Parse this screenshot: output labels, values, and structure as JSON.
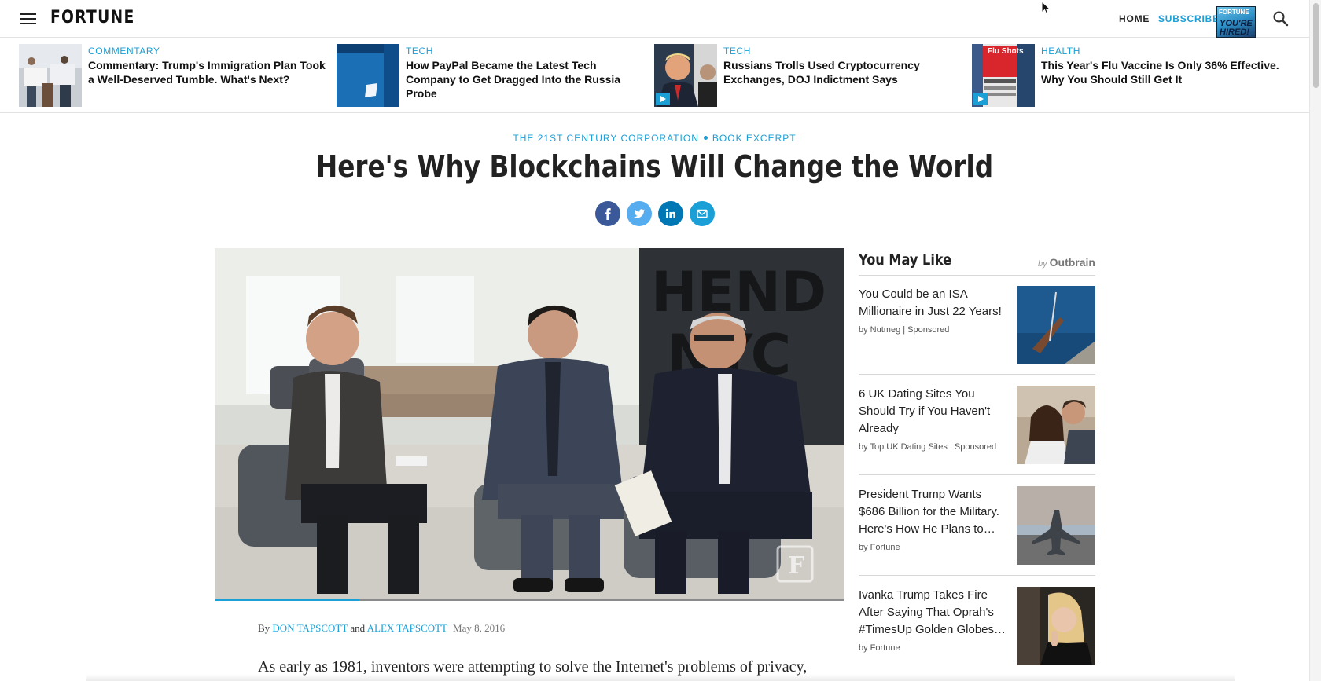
{
  "nav": {
    "logo": "FORTUNE",
    "home": "HOME",
    "subscribe": "SUBSCRIBE",
    "magazine_cover_text": "FORTUNE",
    "magazine_cover_headline": "YOU'RE HIRED!"
  },
  "trending": [
    {
      "category": "COMMENTARY",
      "title": "Commentary: Trump's Immigration Plan Took a Well-Deserved Tumble. What's Next?",
      "video": false
    },
    {
      "category": "TECH",
      "title": "How PayPal Became the Latest Tech Company to Get Dragged Into the Russia Probe",
      "video": false
    },
    {
      "category": "TECH",
      "title": "Russians Trolls Used Cryptocurrency Exchanges, DOJ Indictment Says",
      "video": true
    },
    {
      "category": "HEALTH",
      "title": "This Year's Flu Vaccine Is Only 36% Effective. Why You Should Still Get It",
      "video": true,
      "thumb_text": "Flu Shots"
    }
  ],
  "article": {
    "section": "THE 21ST CENTURY CORPORATION",
    "subsection": "BOOK EXCERPT",
    "headline": "Here's Why Blockchains Will Change the World",
    "byline_prefix": "By",
    "author_1": "DON TAPSCOTT",
    "byline_and": "and",
    "author_2": "ALEX TAPSCOTT",
    "date": "May 8, 2016",
    "body_first_line": "As early as 1981, inventors were attempting to solve the Internet's problems of privacy,",
    "video_progress": 0.23,
    "video_watermark": "F"
  },
  "share": {
    "icons": [
      "facebook-icon",
      "twitter-icon",
      "linkedin-icon",
      "email-icon"
    ],
    "colors": {
      "facebook": "#3b5998",
      "twitter": "#55acee",
      "linkedin": "#0077b5",
      "email": "#1a9fd6"
    }
  },
  "sidebar": {
    "title": "You May Like",
    "by_prefix": "by",
    "by_brand": "Outbrain",
    "items": [
      {
        "title": "You Could be an ISA Millionaire in Just 22 Years!",
        "source": "by Nutmeg | Sponsored"
      },
      {
        "title": "6 UK Dating Sites You Should Try if You Haven't Already",
        "source": "by Top UK Dating Sites | Sponsored"
      },
      {
        "title": "President Trump Wants $686 Billion for the Military. Here's How He Plans to…",
        "source": "by Fortune"
      },
      {
        "title": "Ivanka Trump Takes Fire After Saying That Oprah's #TimesUp Golden Globes…",
        "source": "by Fortune"
      }
    ]
  },
  "colors": {
    "accent": "#1a9fd6",
    "headline": "#222222",
    "text": "#111111"
  }
}
